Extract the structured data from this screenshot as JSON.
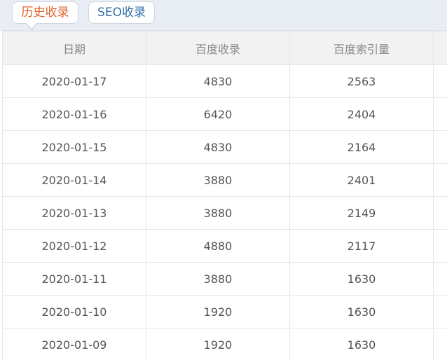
{
  "tabs": [
    {
      "label": "历史收录",
      "active": true
    },
    {
      "label": "SEO收录",
      "active": false
    }
  ],
  "table": {
    "headers": [
      "日期",
      "百度收录",
      "百度索引量"
    ],
    "rows": [
      [
        "2020-01-17",
        "4830",
        "2563"
      ],
      [
        "2020-01-16",
        "6420",
        "2404"
      ],
      [
        "2020-01-15",
        "4830",
        "2164"
      ],
      [
        "2020-01-14",
        "3880",
        "2401"
      ],
      [
        "2020-01-13",
        "3880",
        "2149"
      ],
      [
        "2020-01-12",
        "4880",
        "2117"
      ],
      [
        "2020-01-11",
        "3880",
        "1630"
      ],
      [
        "2020-01-10",
        "1920",
        "1630"
      ],
      [
        "2020-01-09",
        "1920",
        "1630"
      ]
    ]
  },
  "colors": {
    "active_tab_text": "#e0632a",
    "inactive_tab_text": "#2f6fa8",
    "header_bg": "#f2f2f2",
    "topbar_bg": "#e9edf4"
  }
}
